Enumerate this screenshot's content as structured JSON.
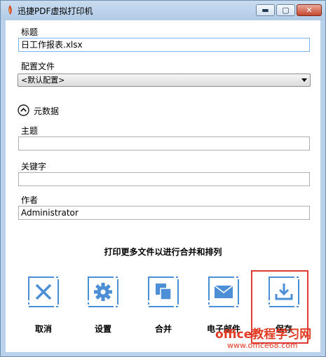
{
  "window": {
    "title": "迅捷PDF虚拟打印机",
    "minimize": "▬",
    "maximize": "▢",
    "close": "✕"
  },
  "form": {
    "title_label": "标题",
    "title_value": "日工作报表.xlsx",
    "profile_label": "配置文件",
    "profile_value": "<默认配置>",
    "metadata_label": "元数据",
    "subject_label": "主题",
    "subject_value": "",
    "keywords_label": "关键字",
    "keywords_value": "",
    "author_label": "作者",
    "author_value": "Administrator"
  },
  "hint": "打印更多文件以进行合并和排列",
  "actions": [
    {
      "label": "取消",
      "icon": "cancel-icon"
    },
    {
      "label": "设置",
      "icon": "gear-icon"
    },
    {
      "label": "合并",
      "icon": "merge-icon"
    },
    {
      "label": "电子邮件",
      "icon": "mail-icon"
    },
    {
      "label": "保存",
      "icon": "download-icon"
    }
  ],
  "watermark": {
    "brand": "office教程学习网",
    "url": "www.office68.com"
  },
  "colors": {
    "accent": "#4d8fd6",
    "highlight": "#e03a35",
    "watermark": "#e23a22"
  }
}
